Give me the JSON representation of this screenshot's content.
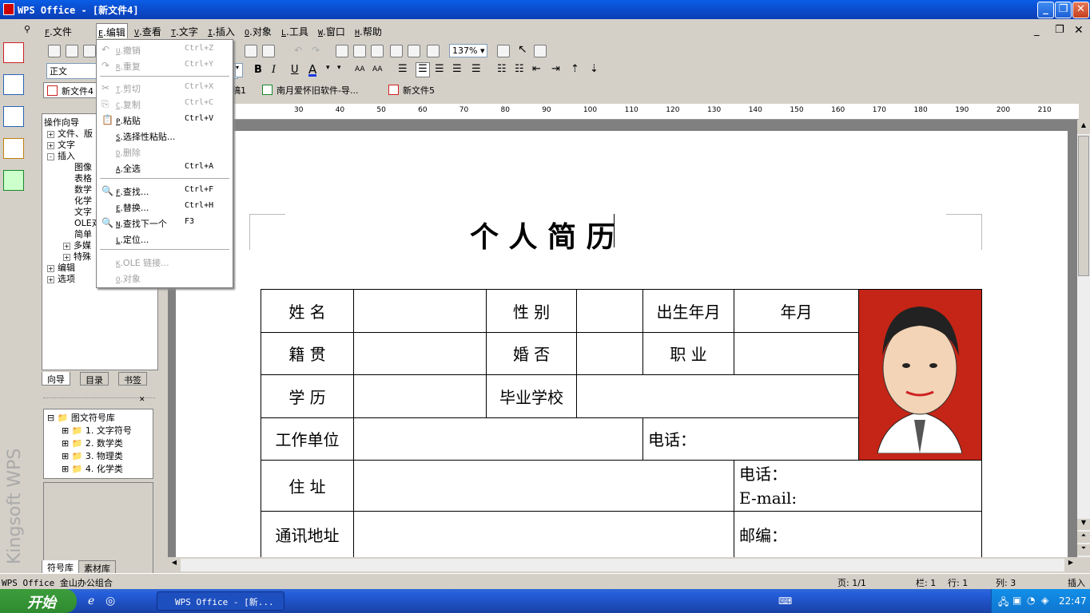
{
  "window": {
    "title": "WPS Office - [新文件4]"
  },
  "menubar": {
    "items": [
      {
        "key": "F",
        "label": "文件"
      },
      {
        "key": "E",
        "label": "编辑"
      },
      {
        "key": "V",
        "label": "查看"
      },
      {
        "key": "T",
        "label": "文字"
      },
      {
        "key": "I",
        "label": "插入"
      },
      {
        "key": "O",
        "label": "对象"
      },
      {
        "key": "L",
        "label": "工具"
      },
      {
        "key": "W",
        "label": "窗口"
      },
      {
        "key": "H",
        "label": "帮助"
      }
    ]
  },
  "toolbar": {
    "style_value": "正文",
    "zoom_value": "137%",
    "font_size_a": "AA",
    "font_size_b": "AA"
  },
  "tabs": [
    {
      "label": "新文件4"
    },
    {
      "label": "稿1"
    },
    {
      "label": "南月爱怀旧软件-导..."
    },
    {
      "label": "新文件5"
    }
  ],
  "edit_menu": {
    "items": [
      {
        "key": "U",
        "label": "撤销",
        "shortcut": "Ctrl+Z"
      },
      {
        "key": "R",
        "label": "重复",
        "shortcut": "Ctrl+Y"
      },
      {
        "key": "T",
        "label": "剪切",
        "shortcut": "Ctrl+X"
      },
      {
        "key": "C",
        "label": "复制",
        "shortcut": "Ctrl+C"
      },
      {
        "key": "P",
        "label": "粘贴",
        "shortcut": "Ctrl+V"
      },
      {
        "key": "S",
        "label": "选择性粘贴...",
        "shortcut": ""
      },
      {
        "key": "D",
        "label": "删除",
        "shortcut": ""
      },
      {
        "key": "A",
        "label": "全选",
        "shortcut": "Ctrl+A"
      },
      {
        "key": "F",
        "label": "查找...",
        "shortcut": "Ctrl+F"
      },
      {
        "key": "E",
        "label": "替换...",
        "shortcut": "Ctrl+H"
      },
      {
        "key": "N",
        "label": "查找下一个",
        "shortcut": "F3"
      },
      {
        "key": "L",
        "label": "定位...",
        "shortcut": ""
      },
      {
        "key": "K",
        "label": "OLE 链接...",
        "shortcut": ""
      },
      {
        "key": "O",
        "label": "对象",
        "shortcut": ""
      }
    ]
  },
  "left_panel": {
    "tree_title": "操作向导",
    "tree": [
      "文件、版",
      "文字",
      "插入",
      "图像",
      "表格",
      "数学",
      "化学",
      "文字",
      "OLE对",
      "简单",
      "多媒",
      "特殊",
      "编辑",
      "选项"
    ],
    "tabs": [
      "向导",
      "目录",
      "书签"
    ],
    "symbol_tree": [
      "图文符号库",
      "1. 文字符号",
      "2. 数学类",
      "3. 物理类",
      "4. 化学类"
    ],
    "bottom_tabs": [
      "符号库",
      "素材库"
    ],
    "brand": "Kingsoft WPS"
  },
  "ruler": {
    "ticks": [
      "30",
      "40",
      "50",
      "60",
      "70",
      "80",
      "90",
      "100",
      "110",
      "120",
      "130",
      "140",
      "150",
      "160",
      "170",
      "180",
      "190",
      "200",
      "210"
    ]
  },
  "document": {
    "title": "个 人 简 历",
    "rows": {
      "r1": [
        "姓 名",
        "性 别",
        "出生年月",
        "年月"
      ],
      "r2": [
        "籍 贯",
        "婚 否",
        "职 业"
      ],
      "r3": [
        "学 历",
        "毕业学校"
      ],
      "r4": [
        "工作单位",
        "电话："
      ],
      "r5": [
        "住 址",
        "电话：",
        "E-mail:"
      ],
      "r6": [
        "通讯地址",
        "邮编："
      ]
    }
  },
  "statusbar": {
    "app": "WPS Office 金山办公组合",
    "page": "页: 1/1",
    "col_bar": "栏: 1",
    "line": "行: 1",
    "col": "列: 3",
    "mode": "插入"
  },
  "taskbar": {
    "start": "开始",
    "task": "WPS Office - [新...",
    "clock": "22:47"
  }
}
